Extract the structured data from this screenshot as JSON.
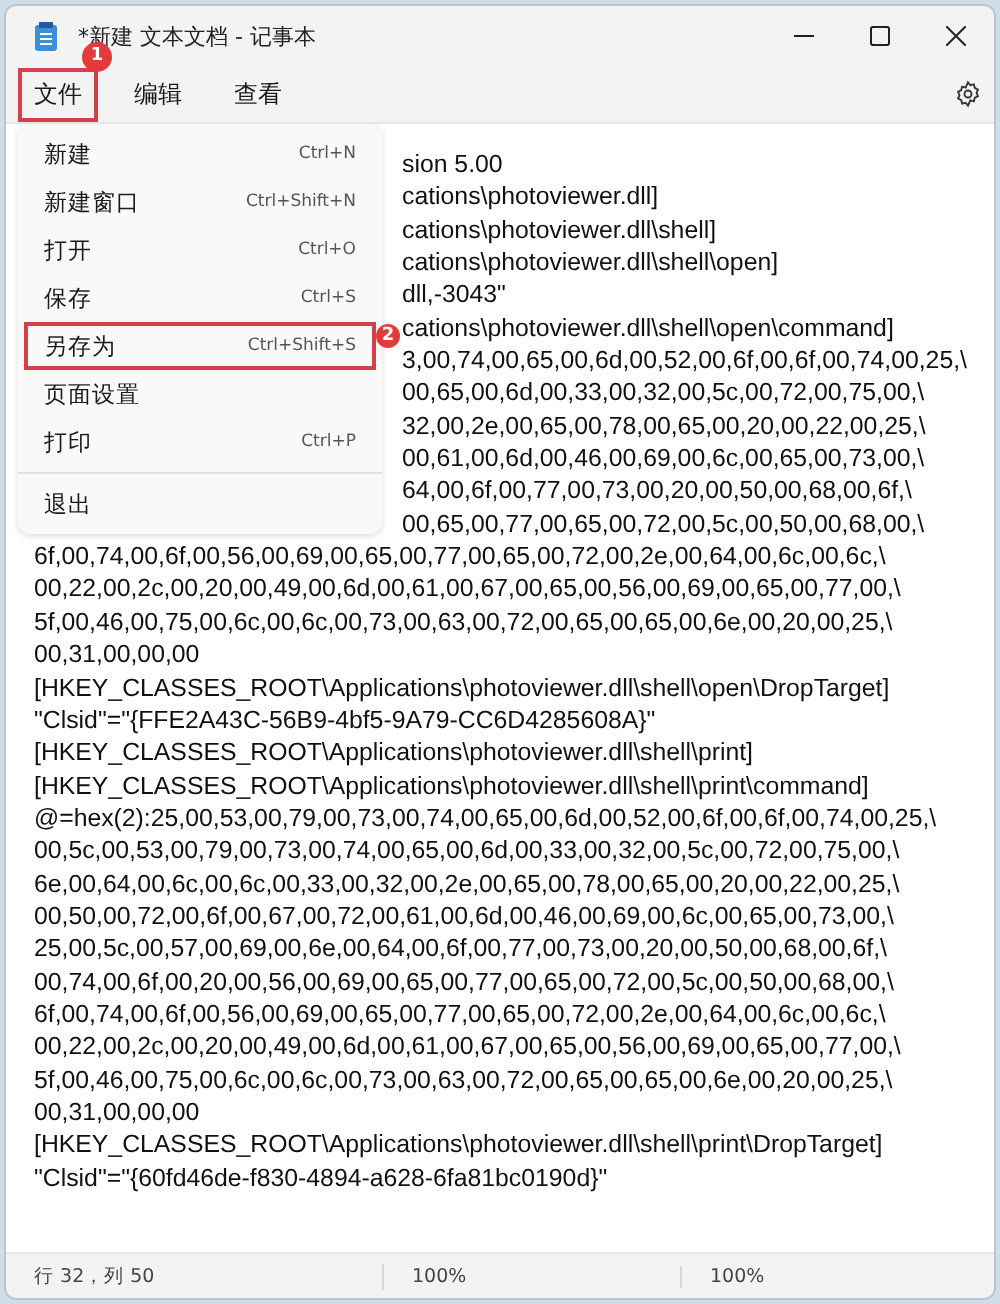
{
  "window": {
    "title": "*新建 文本文档 - 记事本"
  },
  "menu_bar": [
    {
      "label": "文件",
      "selected": true,
      "annotation": "1"
    },
    {
      "label": "编辑",
      "selected": false
    },
    {
      "label": "查看",
      "selected": false
    }
  ],
  "file_menu": [
    {
      "kind": "item",
      "label": "新建",
      "shortcut": "Ctrl+N",
      "selected": false
    },
    {
      "kind": "item",
      "label": "新建窗口",
      "shortcut": "Ctrl+Shift+N",
      "selected": false
    },
    {
      "kind": "item",
      "label": "打开",
      "shortcut": "Ctrl+O",
      "selected": false
    },
    {
      "kind": "item",
      "label": "保存",
      "shortcut": "Ctrl+S",
      "selected": false
    },
    {
      "kind": "item",
      "label": "另存为",
      "shortcut": "Ctrl+Shift+S",
      "selected": true,
      "annotation": "2"
    },
    {
      "kind": "item",
      "label": "页面设置",
      "selected": false
    },
    {
      "kind": "item",
      "label": "打印",
      "shortcut": "Ctrl+P",
      "selected": false
    },
    {
      "kind": "divider"
    },
    {
      "kind": "item",
      "label": "退出",
      "selected": false
    }
  ],
  "editor_lines": [
    {
      "kind": "partial",
      "text": "sion 5.00"
    },
    {
      "kind": "partial",
      "text": "cations\\photoviewer.dll]"
    },
    {
      "kind": "partial",
      "text": "cations\\photoviewer.dll\\shell]"
    },
    {
      "kind": "partial",
      "text": "cations\\photoviewer.dll\\shell\\open]"
    },
    {
      "kind": "partial",
      "text": "dll,-3043\""
    },
    {
      "kind": "partial",
      "text": "cations\\photoviewer.dll\\shell\\open\\command]"
    },
    {
      "kind": "partial",
      "text": "3,00,74,00,65,00,6d,00,52,00,6f,00,6f,00,74,00,25,\\"
    },
    {
      "kind": "partial",
      "text": "00,65,00,6d,00,33,00,32,00,5c,00,72,00,75,00,\\"
    },
    {
      "kind": "partial",
      "text": "32,00,2e,00,65,00,78,00,65,00,20,00,22,00,25,\\"
    },
    {
      "kind": "partial",
      "text": "00,61,00,6d,00,46,00,69,00,6c,00,65,00,73,00,\\"
    },
    {
      "kind": "partial",
      "text": "64,00,6f,00,77,00,73,00,20,00,50,00,68,00,6f,\\"
    },
    {
      "kind": "partial",
      "text": "00,65,00,77,00,65,00,72,00,5c,00,50,00,68,00,\\"
    },
    {
      "kind": "full",
      "text": "6f,00,74,00,6f,00,56,00,69,00,65,00,77,00,65,00,72,00,2e,00,64,00,6c,00,6c,\\"
    },
    {
      "kind": "full",
      "text": "00,22,00,2c,00,20,00,49,00,6d,00,61,00,67,00,65,00,56,00,69,00,65,00,77,00,\\"
    },
    {
      "kind": "full",
      "text": "5f,00,46,00,75,00,6c,00,6c,00,73,00,63,00,72,00,65,00,65,00,6e,00,20,00,25,\\"
    },
    {
      "kind": "full",
      "text": "00,31,00,00,00"
    },
    {
      "kind": "full",
      "text": "[HKEY_CLASSES_ROOT\\Applications\\photoviewer.dll\\shell\\open\\DropTarget]"
    },
    {
      "kind": "full",
      "text": "\"Clsid\"=\"{FFE2A43C-56B9-4bf5-9A79-CC6D4285608A}\""
    },
    {
      "kind": "full",
      "text": "[HKEY_CLASSES_ROOT\\Applications\\photoviewer.dll\\shell\\print]"
    },
    {
      "kind": "full",
      "text": "[HKEY_CLASSES_ROOT\\Applications\\photoviewer.dll\\shell\\print\\command]"
    },
    {
      "kind": "full",
      "text": "@=hex(2):25,00,53,00,79,00,73,00,74,00,65,00,6d,00,52,00,6f,00,6f,00,74,00,25,\\"
    },
    {
      "kind": "full",
      "text": "00,5c,00,53,00,79,00,73,00,74,00,65,00,6d,00,33,00,32,00,5c,00,72,00,75,00,\\"
    },
    {
      "kind": "full",
      "text": "6e,00,64,00,6c,00,6c,00,33,00,32,00,2e,00,65,00,78,00,65,00,20,00,22,00,25,\\"
    },
    {
      "kind": "full",
      "text": "00,50,00,72,00,6f,00,67,00,72,00,61,00,6d,00,46,00,69,00,6c,00,65,00,73,00,\\"
    },
    {
      "kind": "full",
      "text": "25,00,5c,00,57,00,69,00,6e,00,64,00,6f,00,77,00,73,00,20,00,50,00,68,00,6f,\\"
    },
    {
      "kind": "full",
      "text": "00,74,00,6f,00,20,00,56,00,69,00,65,00,77,00,65,00,72,00,5c,00,50,00,68,00,\\"
    },
    {
      "kind": "full",
      "text": "6f,00,74,00,6f,00,56,00,69,00,65,00,77,00,65,00,72,00,2e,00,64,00,6c,00,6c,\\"
    },
    {
      "kind": "full",
      "text": "00,22,00,2c,00,20,00,49,00,6d,00,61,00,67,00,65,00,56,00,69,00,65,00,77,00,\\"
    },
    {
      "kind": "full",
      "text": "5f,00,46,00,75,00,6c,00,6c,00,73,00,63,00,72,00,65,00,65,00,6e,00,20,00,25,\\"
    },
    {
      "kind": "full",
      "text": "00,31,00,00,00"
    },
    {
      "kind": "full",
      "text": "[HKEY_CLASSES_ROOT\\Applications\\photoviewer.dll\\shell\\print\\DropTarget]"
    },
    {
      "kind": "full",
      "text": "\"Clsid\"=\"{60fd46de-f830-4894-a628-6fa81bc0190d}\""
    }
  ],
  "status_bar": [
    "行 32，列 50",
    "100%",
    "100%"
  ]
}
